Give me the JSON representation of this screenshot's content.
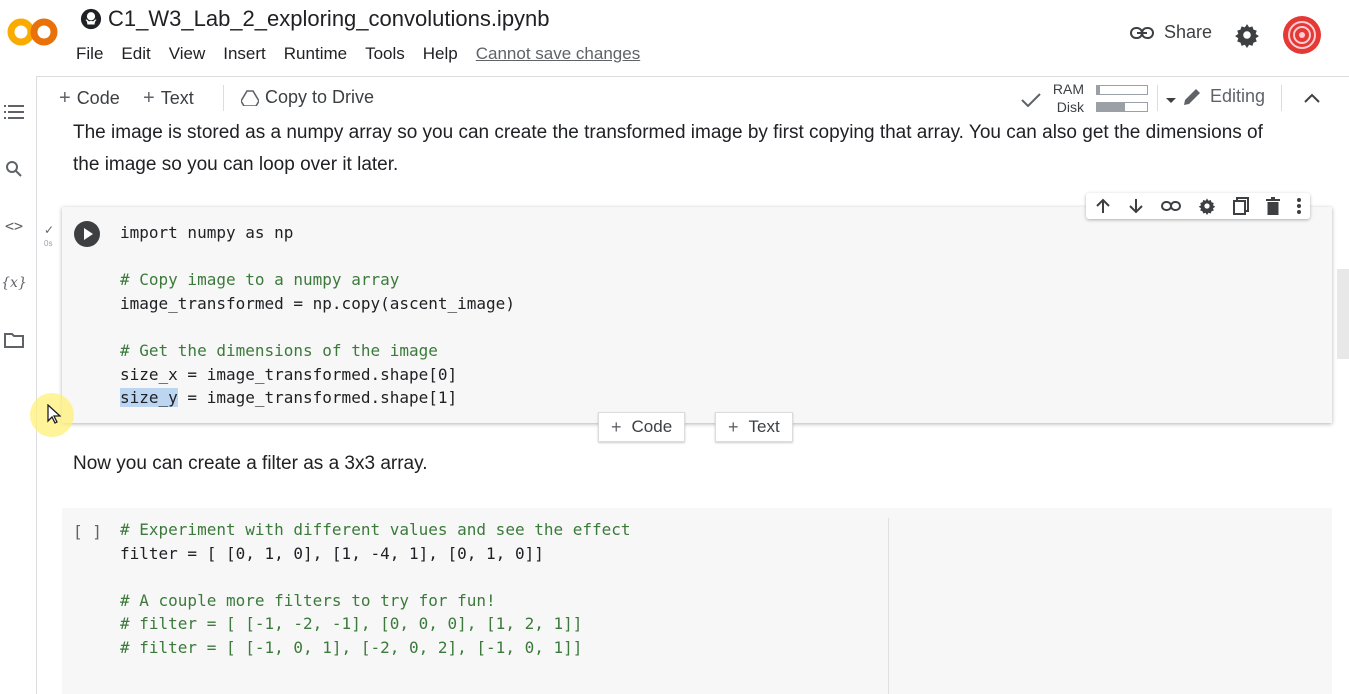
{
  "header": {
    "logo_text": "CO",
    "title": "C1_W3_Lab_2_exploring_convolutions.ipynb",
    "menu": [
      "File",
      "Edit",
      "View",
      "Insert",
      "Runtime",
      "Tools",
      "Help"
    ],
    "save_status": "Cannot save changes",
    "share_label": "Share"
  },
  "rail": {
    "icons": [
      "table-of-contents-icon",
      "search-icon",
      "code-snippets-icon",
      "variables-icon",
      "files-icon"
    ],
    "variables_glyph": "{x}",
    "code_glyph": "<>"
  },
  "toolbar": {
    "add_code": "Code",
    "add_text": "Text",
    "copy_to_drive": "Copy to Drive",
    "ram_label": "RAM",
    "disk_label": "Disk",
    "ram_usage": 0.05,
    "disk_usage": 0.55,
    "editing_label": "Editing"
  },
  "cells": {
    "text1_line1": "The image is stored as a numpy array so you can create the transformed image by first copying that array. You can also get the dimensions of",
    "text1_line2": "the image so you can loop over it later.",
    "code1": {
      "status_check": "✓",
      "status_time": "0s",
      "line1": "import numpy as np",
      "line2": "# Copy image to a numpy array",
      "line3": "image_transformed = np.copy(ascent_image)",
      "line4": "# Get the dimensions of the image",
      "line5": "size_x = image_transformed.shape[0]",
      "line6_sel": "size_y",
      "line6_rest": " = image_transformed.shape[1]"
    },
    "add_code": "Code",
    "add_text": "Text",
    "text2": "Now you can create a filter as a 3x3 array.",
    "code2": {
      "bracket": "[ ]",
      "line1": "# Experiment with different values and see the effect",
      "line2": "filter = [ [0, 1, 0], [1, -4, 1], [0, 1, 0]]",
      "line3": "# A couple more filters to try for fun!",
      "line4": "# filter = [ [-1, -2, -1], [0, 0, 0], [1, 2, 1]]",
      "line5": "# filter = [ [-1, 0, 1], [-2, 0, 2], [-1, 0, 1]]"
    }
  },
  "colors": {
    "logo_orange": "#f9ab00",
    "logo_dark_orange": "#e8710a",
    "comment_green": "#3b7a3b",
    "selection_blue": "#bcd6f2"
  }
}
